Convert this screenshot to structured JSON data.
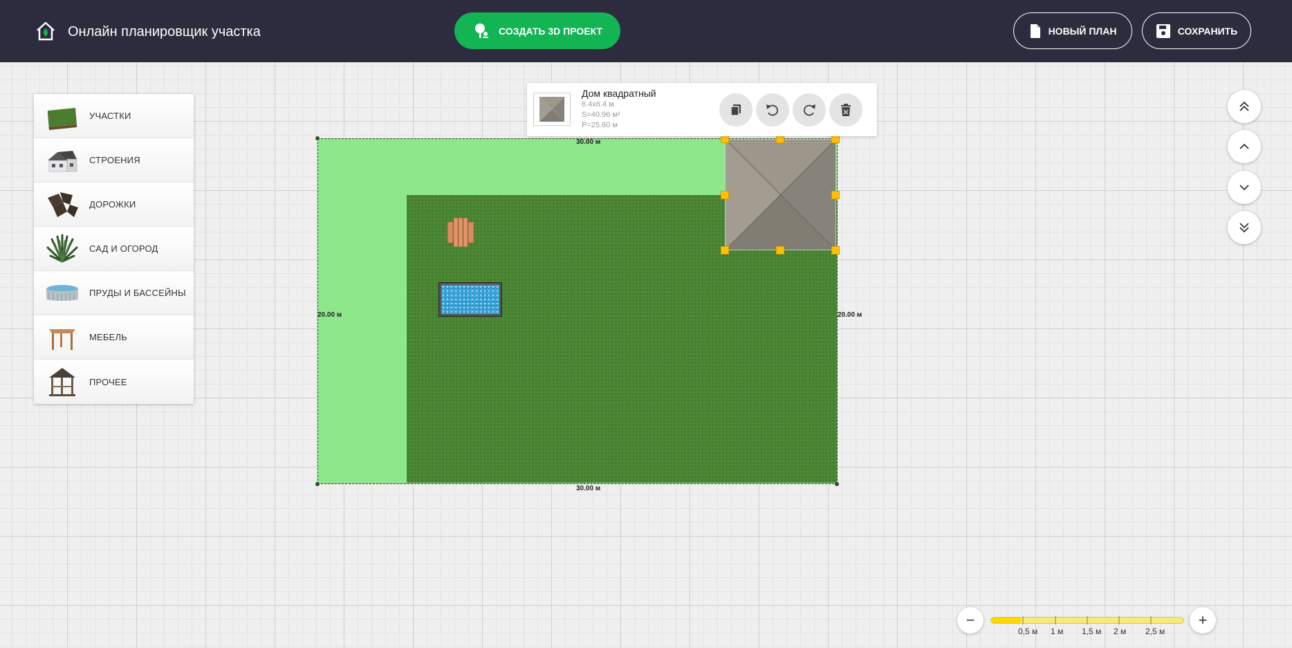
{
  "header": {
    "title": "Онлайн планировщик участка",
    "create_3d_label": "СОЗДАТЬ 3D ПРОЕКТ",
    "new_plan_label": "НОВЫЙ ПЛАН",
    "save_label": "СОХРАНИТЬ"
  },
  "sidebar": {
    "items": [
      {
        "label": "УЧАСТКИ",
        "icon": "lawn-icon"
      },
      {
        "label": "СТРОЕНИЯ",
        "icon": "house-icon"
      },
      {
        "label": "ДОРОЖКИ",
        "icon": "paving-icon"
      },
      {
        "label": "САД И ОГОРОД",
        "icon": "plant-icon"
      },
      {
        "label": "ПРУДЫ И БАССЕЙНЫ",
        "icon": "pool-icon"
      },
      {
        "label": "МЕБЕЛЬ",
        "icon": "table-icon"
      },
      {
        "label": "ПРОЧЕЕ",
        "icon": "gazebo-icon"
      }
    ]
  },
  "info_panel": {
    "name": "Дом квадратный",
    "size": "6.4x6.4 м",
    "area": "S=40.96 м²",
    "perimeter": "P=25.60 м"
  },
  "plot": {
    "top_label": "30.00 м",
    "bottom_label": "30.00 м",
    "left_label": "20.00 м",
    "right_label": "20.00 м"
  },
  "zoom": {
    "labels": [
      "0,5 м",
      "1 м",
      "1,5 м",
      "2 м",
      "2,5 м"
    ],
    "level": 0.16
  },
  "colors": {
    "header_bg": "#2c2c3e",
    "accent_green": "#13b454",
    "plot_light": "#8ee88a",
    "lawn": "#4b8734",
    "handle": "#ffc107"
  }
}
